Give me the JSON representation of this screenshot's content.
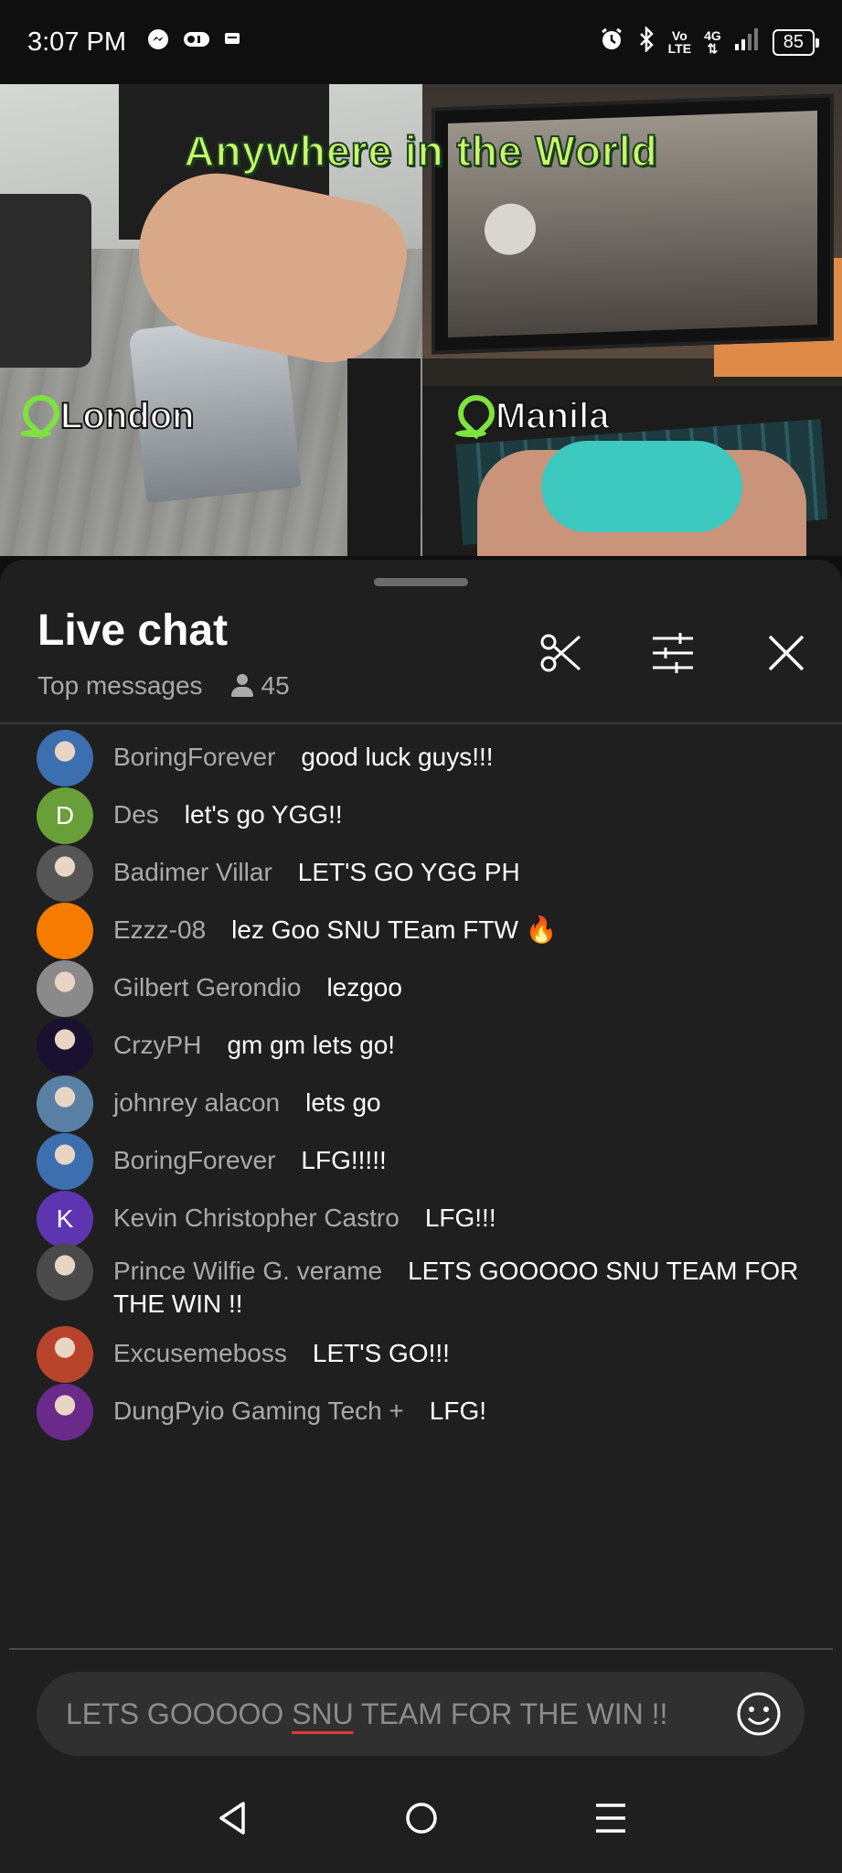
{
  "status_bar": {
    "time": "3:07 PM",
    "net_top": "Vo",
    "net_bottom": "LTE",
    "signal_label": "4G",
    "battery": "85"
  },
  "video": {
    "title": "Anywhere in the World",
    "left_city": "London",
    "right_city": "Manila",
    "accent_color": "#c9f56b",
    "pin_color": "#7ee33e"
  },
  "chat": {
    "title": "Live chat",
    "filter_label": "Top messages",
    "viewer_count": "45",
    "messages": [
      {
        "author": "BoringForever",
        "text": "good luck guys!!!",
        "avatar": {
          "type": "image",
          "color": "#3b6fb0"
        }
      },
      {
        "author": "Des",
        "text": "let's go YGG!!",
        "avatar": {
          "type": "letter",
          "letter": "D",
          "color": "#689f38"
        }
      },
      {
        "author": "Badimer Villar",
        "text": "LET'S GO YGG PH",
        "avatar": {
          "type": "image",
          "color": "#555555"
        }
      },
      {
        "author": "Ezzz-08",
        "text": "lez Goo SNU TEam FTW 🔥",
        "avatar": {
          "type": "solid",
          "color": "#f57c00"
        }
      },
      {
        "author": "Gilbert Gerondio",
        "text": "lezgoo",
        "avatar": {
          "type": "image",
          "color": "#8a8a8a"
        }
      },
      {
        "author": "CrzyPH",
        "text": "gm gm lets go!",
        "avatar": {
          "type": "image",
          "color": "#1a1030"
        }
      },
      {
        "author": "johnrey alacon",
        "text": "lets go",
        "avatar": {
          "type": "image",
          "color": "#5a7fa5"
        }
      },
      {
        "author": "BoringForever",
        "text": "LFG!!!!!",
        "avatar": {
          "type": "image",
          "color": "#3b6fb0"
        }
      },
      {
        "author": "Kevin Christopher Castro",
        "text": "LFG!!!",
        "avatar": {
          "type": "letter",
          "letter": "K",
          "color": "#5e35b1"
        }
      },
      {
        "author": "Prince Wilfie G. verame",
        "text": "LETS GOOOOO SNU TEAM FOR THE WIN !!",
        "avatar": {
          "type": "image",
          "color": "#4a4a4a"
        }
      },
      {
        "author": "Excusemeboss",
        "text": "LET'S GO!!!",
        "avatar": {
          "type": "image",
          "color": "#b8432b"
        }
      },
      {
        "author": "DungPyio Gaming Tech +",
        "text": "LFG!",
        "avatar": {
          "type": "image",
          "color": "#6a2a8a"
        }
      }
    ]
  },
  "input": {
    "text_before": "LETS GOOOOO ",
    "text_flagged": "SNU",
    "text_after": " TEAM FOR THE WIN !!"
  }
}
